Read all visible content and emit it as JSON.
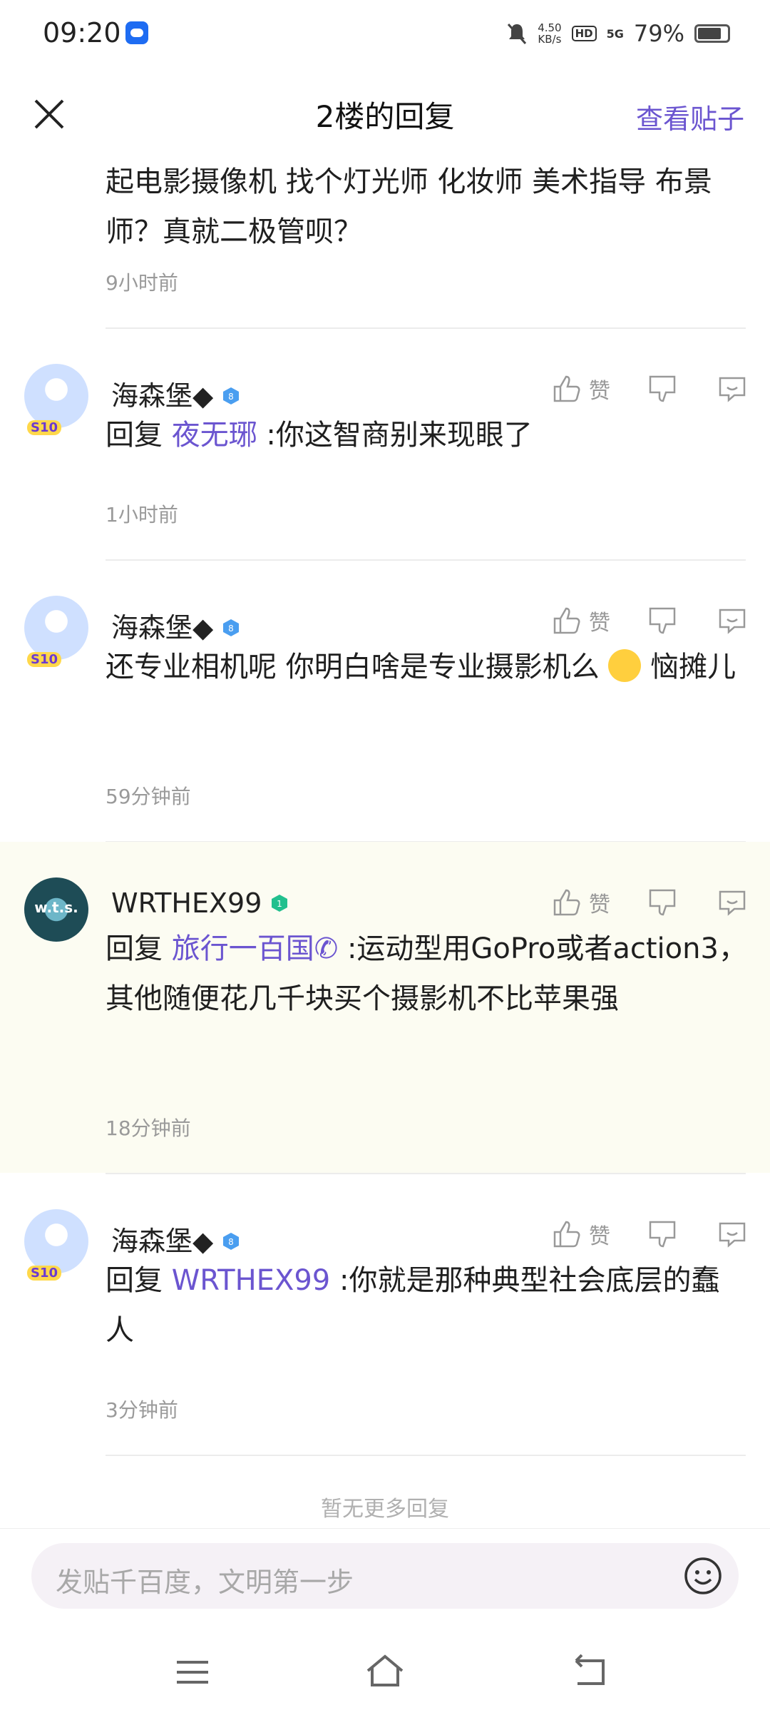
{
  "status_bar": {
    "time": "09:20",
    "speed_value": "4.50",
    "speed_unit": "KB/s",
    "hd": "HD",
    "network": "5G",
    "battery": "79%"
  },
  "header": {
    "title": "2楼的回复",
    "view_post": "查看贴子"
  },
  "first_comment": {
    "text": "起电影摄像机 找个灯光师 化妆师 美术指导 布景师？真就二极管呗？",
    "time": "9小时前"
  },
  "like_label": "赞",
  "replies": [
    {
      "username": "海森堡◆",
      "level_badge": "8",
      "avatar_badge": "S10",
      "prefix": "回复 ",
      "mention": "夜无琊",
      "text": " :你这智商别来现眼了",
      "time": "1小时前"
    },
    {
      "username": "海森堡◆",
      "level_badge": "8",
      "avatar_badge": "S10",
      "text_before": "还专业相机呢 你明白啥是专业摄影机么 ",
      "text_after": " 恼摊儿",
      "time": "59分钟前"
    },
    {
      "username": "WRTHEX99",
      "level_badge": "1",
      "avatar_text": "w.t.s.",
      "prefix": "回复 ",
      "mention": "旅行一百国✆",
      "text": " :运动型用GoPro或者action3，其他随便花几千块买个摄影机不比苹果强",
      "time": "18分钟前"
    },
    {
      "username": "海森堡◆",
      "level_badge": "8",
      "avatar_badge": "S10",
      "prefix": "回复 ",
      "mention": "WRTHEX99",
      "text": " :你就是那种典型社会底层的蠢人",
      "time": "3分钟前"
    }
  ],
  "no_more": "暂无更多回复",
  "input": {
    "placeholder": "发贴千百度，文明第一步"
  },
  "colors": {
    "accent": "#6b55d0",
    "highlight_bg": "#fcfcf2"
  }
}
